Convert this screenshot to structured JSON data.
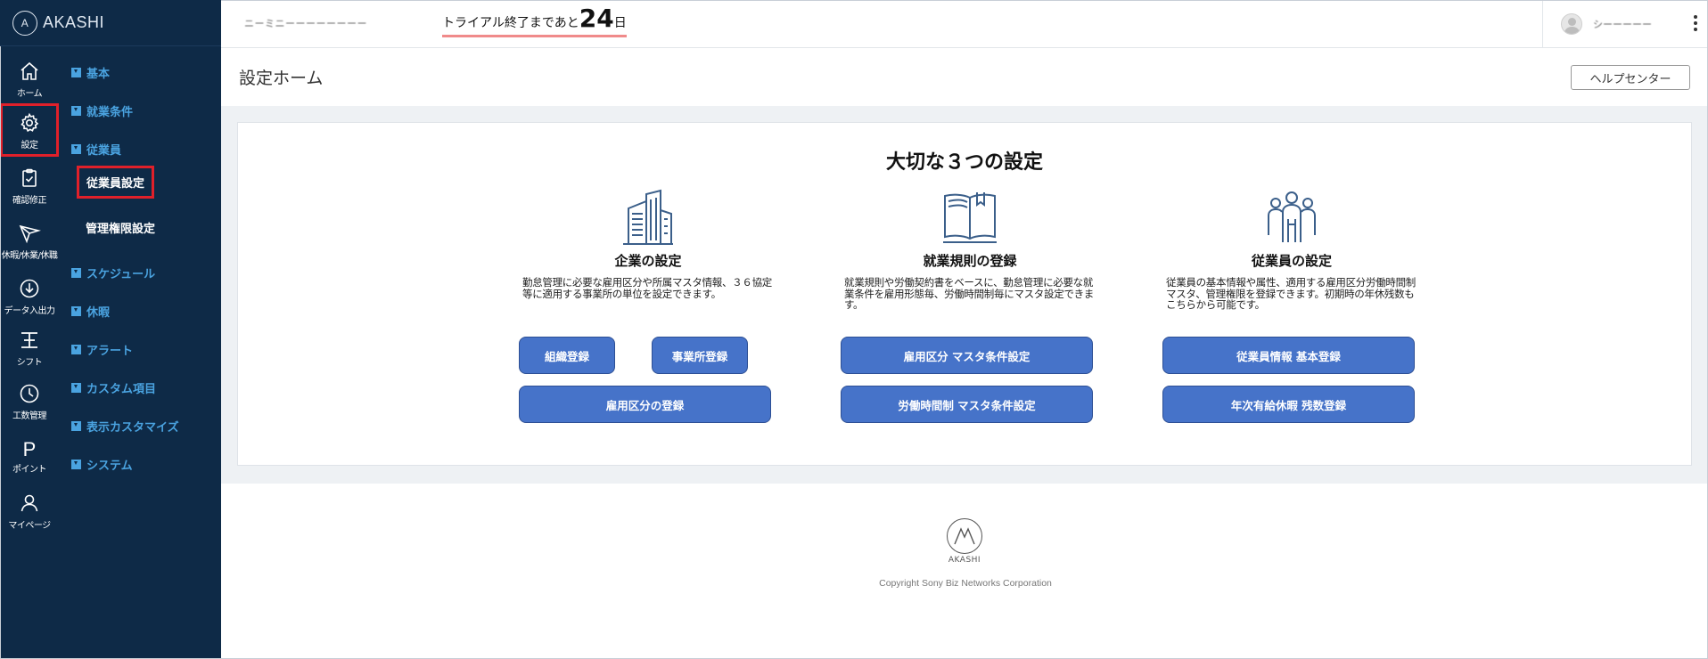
{
  "app": {
    "logo_text": "AKASHI",
    "logo_mark": "A"
  },
  "rail": [
    {
      "label": "ホーム",
      "icon": "home-icon"
    },
    {
      "label": "設定",
      "icon": "gear-icon"
    },
    {
      "label": "確認修正",
      "icon": "clipboard-check-icon"
    },
    {
      "label": "休暇/休業/休職",
      "icon": "plane-icon"
    },
    {
      "label": "データ入出力",
      "icon": "download-icon"
    },
    {
      "label": "シフト",
      "icon": "shift-icon"
    },
    {
      "label": "工数管理",
      "icon": "clock-icon"
    },
    {
      "label": "ポイント",
      "icon": "point-icon",
      "glyph": "P"
    },
    {
      "label": "マイページ",
      "icon": "user-icon"
    }
  ],
  "menu": {
    "categories": [
      "基本",
      "就業条件",
      "従業員",
      "スケジュール",
      "休暇",
      "アラート",
      "カスタム項目",
      "表示カスタマイズ",
      "システム"
    ],
    "subitems": [
      "従業員設定",
      "管理権限設定"
    ]
  },
  "header": {
    "company_name": "ニーミニーーーーーーーー",
    "trial_prefix": "トライアル終了まであと",
    "trial_days": "24",
    "trial_suffix": "日",
    "user_name": "シーーーーー"
  },
  "page": {
    "title": "設定ホーム",
    "help_button": "ヘルプセンター"
  },
  "card": {
    "title": "大切な３つの設定",
    "columns": [
      {
        "icon": "building-icon",
        "heading": "企業の設定",
        "description": "勤怠管理に必要な雇用区分や所属マスタ情報、３６協定等に適用する事業所の単位を設定できます。",
        "buttons": [
          "組織登録",
          "事業所登録",
          "雇用区分の登録"
        ]
      },
      {
        "icon": "book-icon",
        "heading": "就業規則の登録",
        "description": "就業規則や労働契約書をベースに、勤怠管理に必要な就業条件を雇用形態毎、労働時間制毎にマスタ設定できます。",
        "buttons": [
          "雇用区分 マスタ条件設定",
          "労働時間制 マスタ条件設定"
        ]
      },
      {
        "icon": "people-icon",
        "heading": "従業員の設定",
        "description": "従業員の基本情報や属性、適用する雇用区分労働時間制マスタ、管理権限を登録できます。初期時の年休残数もこちらから可能です。",
        "buttons": [
          "従業員情報 基本登録",
          "年次有給休暇 残数登録"
        ]
      }
    ]
  },
  "footer": {
    "brand": "AKASHI",
    "copyright": "Copyright Sony Biz Networks Corporation"
  },
  "colors": {
    "sidebar": "#0e2a47",
    "menu_accent": "#4aa3e0",
    "button": "#4673c9",
    "highlight": "#e0202a"
  }
}
